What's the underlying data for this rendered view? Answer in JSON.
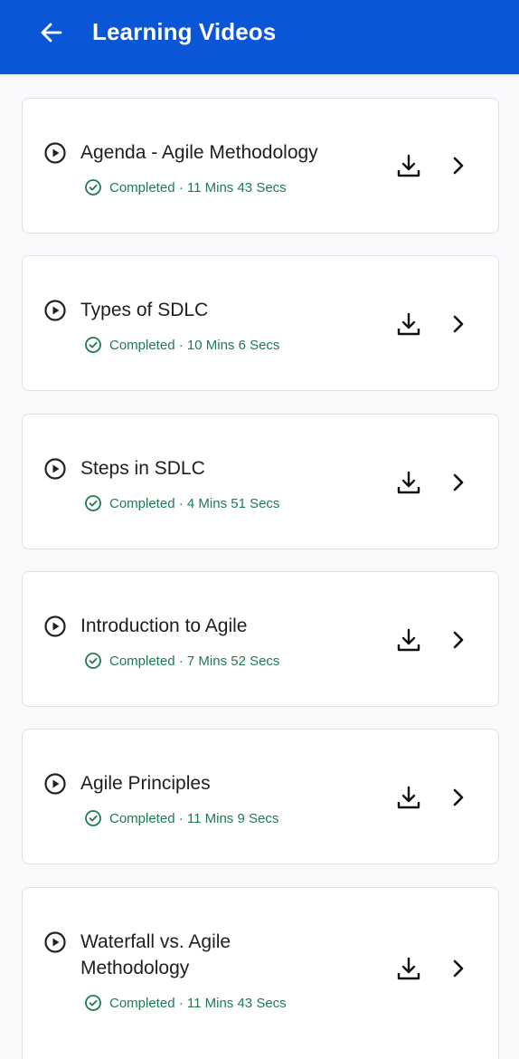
{
  "header": {
    "title": "Learning Videos",
    "back_icon": "arrow-left-icon",
    "background": "#0a56d6"
  },
  "status_color": "#1f7a52",
  "videos": [
    {
      "title": "Agenda - Agile Methodology",
      "status": "Completed",
      "separator": "·",
      "duration": "11 Mins 43 Secs"
    },
    {
      "title": "Types of SDLC",
      "status": "Completed",
      "separator": "·",
      "duration": "10 Mins 6 Secs"
    },
    {
      "title": "Steps in SDLC",
      "status": "Completed",
      "separator": "·",
      "duration": "4 Mins 51 Secs"
    },
    {
      "title": "Introduction to Agile",
      "status": "Completed",
      "separator": "·",
      "duration": "7 Mins 52 Secs"
    },
    {
      "title": "Agile Principles",
      "status": "Completed",
      "separator": "·",
      "duration": "11 Mins 9 Secs"
    },
    {
      "title": "Waterfall vs. Agile Methodology",
      "status": "Completed",
      "separator": "·",
      "duration": "11 Mins 43 Secs"
    }
  ],
  "icons": {
    "play": "play-circle-icon",
    "completed": "check-circle-icon",
    "download": "download-icon",
    "open": "chevron-right-icon"
  }
}
